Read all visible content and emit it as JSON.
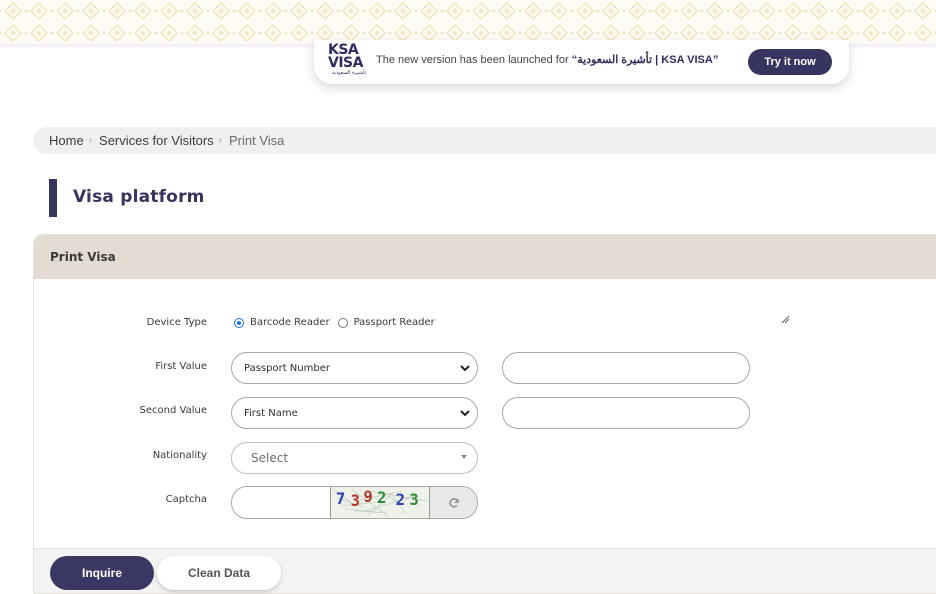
{
  "announcement": {
    "logo_line1": "KSA",
    "logo_line2": "VISA",
    "logo_tagline": "تأشيرة السعودية",
    "text_prefix": "The new version has been launched for ",
    "text_highlight": "“تأشيرة السعودية | KSA VISA”",
    "try_label": "Try it now"
  },
  "breadcrumb": {
    "items": [
      "Home",
      "Services for Visitors",
      "Print Visa"
    ],
    "separator": "›"
  },
  "page_title": "Visa platform",
  "panel": {
    "title": "Print Visa"
  },
  "form": {
    "device_type": {
      "label": "Device Type",
      "options": [
        "Barcode Reader",
        "Passport Reader"
      ],
      "selected": "Barcode Reader"
    },
    "first_value": {
      "label": "First Value",
      "selected": "Passport Number",
      "input_value": ""
    },
    "second_value": {
      "label": "Second Value",
      "selected": "First Name",
      "input_value": ""
    },
    "nationality": {
      "label": "Nationality",
      "placeholder": "Select"
    },
    "captcha": {
      "label": "Captcha",
      "input_value": "",
      "digits": [
        "7",
        "3",
        "9",
        "2",
        "2",
        "3"
      ],
      "digit_colors": [
        "#2b3fb0",
        "#b23a2a",
        "#b23a2a",
        "#2f8a3a",
        "#2b3fb0",
        "#2f8a3a"
      ]
    }
  },
  "buttons": {
    "inquire": "Inquire",
    "clean": "Clean Data"
  },
  "colors": {
    "brand": "#37355f",
    "panel_header": "#e4dcd3",
    "radio_accent": "#1a73e8"
  }
}
